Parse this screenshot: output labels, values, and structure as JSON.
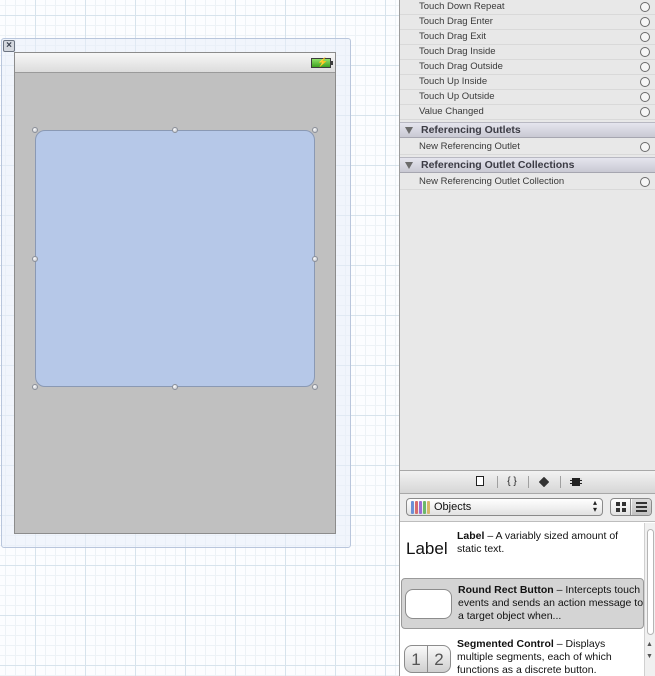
{
  "canvas": {
    "close_glyph": "×",
    "battery_bolt": "⚡"
  },
  "inspector": {
    "events": [
      {
        "label": "Touch Down Repeat"
      },
      {
        "label": "Touch Drag Enter"
      },
      {
        "label": "Touch Drag Exit"
      },
      {
        "label": "Touch Drag Inside"
      },
      {
        "label": "Touch Drag Outside"
      },
      {
        "label": "Touch Up Inside"
      },
      {
        "label": "Touch Up Outside"
      },
      {
        "label": "Value Changed"
      }
    ],
    "referencing_outlets": {
      "title": "Referencing Outlets",
      "item": "New Referencing Outlet"
    },
    "referencing_outlet_collections": {
      "title": "Referencing Outlet Collections",
      "item": "New Referencing Outlet Collection"
    }
  },
  "library": {
    "tabs": [
      {
        "name": "file-template-library",
        "icon": "document-icon"
      },
      {
        "name": "code-snippet-library",
        "glyph": "{ }",
        "icon": "braces-icon"
      },
      {
        "name": "object-library",
        "icon": "cube-icon"
      },
      {
        "name": "media-library",
        "icon": "film-icon"
      }
    ],
    "selected_library": "Objects",
    "items": [
      {
        "preview_text": "Label",
        "title": "Label",
        "description": " – A variably sized amount of static text."
      },
      {
        "title": "Round Rect Button",
        "description": " – Intercepts touch events and sends an action message to a target object when..."
      },
      {
        "segments": [
          "1",
          "2"
        ],
        "title": "Segmented Control",
        "description": " – Displays multiple segments, each of which functions as a discrete button."
      }
    ]
  },
  "colors": {
    "selected_view_fill": "#b6c8e8",
    "device_background": "#c0c0c0",
    "inspector_background": "#e8e8e8",
    "selected_library_row": "#d4d4d4"
  }
}
